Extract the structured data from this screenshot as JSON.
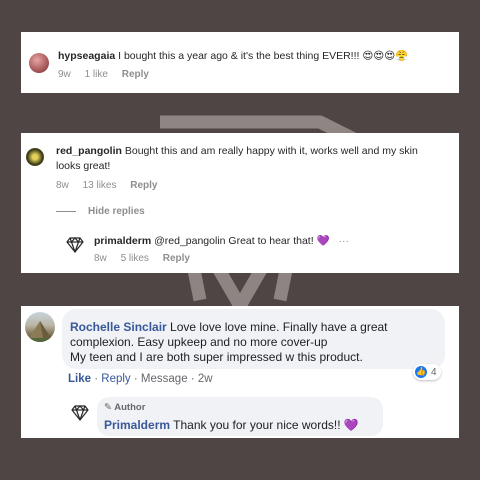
{
  "comments": [
    {
      "username": "hypseagaia",
      "text": "I bought this a year ago & it's the best thing EVER!!!",
      "emojis": "😍😍😍😤",
      "age": "9w",
      "likes": "1 like",
      "reply_label": "Reply"
    },
    {
      "username": "red_pangolin",
      "text_line1": "Bought this and am really happy with it, works well and my skin",
      "text_line2": "looks great!",
      "age": "8w",
      "likes": "13 likes",
      "reply_label": "Reply",
      "hide_replies_label": "Hide replies",
      "reply": {
        "username": "primalderm",
        "text": "@red_pangolin Great to hear that!",
        "emoji": "💜",
        "more": "···",
        "age": "8w",
        "likes": "5 likes",
        "reply_label": "Reply"
      }
    },
    {
      "name": "Rochelle Sinclair",
      "text_line1": "Love love love mine. Finally have a great",
      "text_line2": "complexion. Easy upkeep and no more cover-up",
      "text_line3": "My teen and I are both super impressed w this product.",
      "like_label": "Like",
      "reply_label": "Reply",
      "message_label": "Message",
      "age": "2w",
      "sep": "·",
      "reaction_count": "4",
      "reply": {
        "badge": "Author",
        "name": "Primalderm",
        "text": "Thank you for your nice words!!",
        "emoji": "💜"
      }
    }
  ],
  "colors": {
    "background": "#4e4544",
    "fb_link": "#385898",
    "like_blue": "#1877f2",
    "purple_heart": "#9b59d0"
  }
}
